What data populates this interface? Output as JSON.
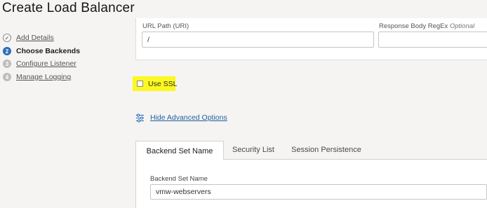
{
  "header": {
    "title": "Create Load Balancer"
  },
  "steps": [
    {
      "num": "✓",
      "label": "Add Details",
      "state": "done"
    },
    {
      "num": "2",
      "label": "Choose Backends",
      "state": "active"
    },
    {
      "num": "3",
      "label": "Configure Listener",
      "state": "todo"
    },
    {
      "num": "4",
      "label": "Manage Logging",
      "state": "todo"
    }
  ],
  "health_check": {
    "url_path_label": "URL Path (URI)",
    "url_path_value": "/",
    "response_regex_label": "Response Body RegEx",
    "response_regex_optional": "Optional",
    "response_regex_value": ""
  },
  "ssl": {
    "label": "Use SSL",
    "checked": false,
    "highlight_color": "#fbf91f"
  },
  "advanced": {
    "link_label": "Hide Advanced Options",
    "icon": "sliders-icon"
  },
  "tabs": [
    {
      "label": "Backend Set Name",
      "active": true
    },
    {
      "label": "Security List",
      "active": false
    },
    {
      "label": "Session Persistence",
      "active": false
    }
  ],
  "backend_set": {
    "field_label": "Backend Set Name",
    "value": "vmw-webservers"
  },
  "colors": {
    "accent": "#2a6ebb",
    "link": "#1f5f9e"
  }
}
